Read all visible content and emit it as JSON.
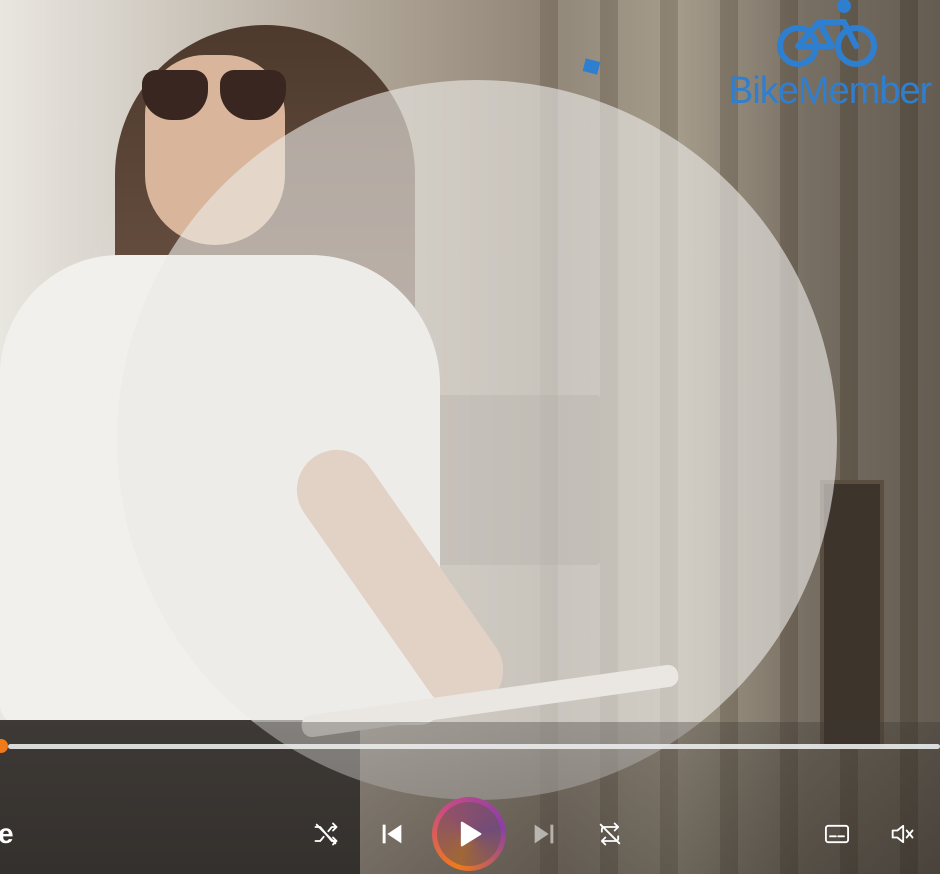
{
  "brand": {
    "name": "BikeMember",
    "color": "#2f7fd0",
    "icon": "bicycle-rider-icon"
  },
  "player": {
    "title_fragment": "e",
    "progress": 0.0,
    "accent_color": "#f07a1a",
    "controls": {
      "shuffle": "shuffle-icon",
      "previous": "skip-previous-icon",
      "play": "play-icon",
      "next": "skip-next-icon",
      "repeat": "repeat-off-icon",
      "subtitles": "subtitles-icon",
      "volume": "volume-muted-icon"
    }
  }
}
